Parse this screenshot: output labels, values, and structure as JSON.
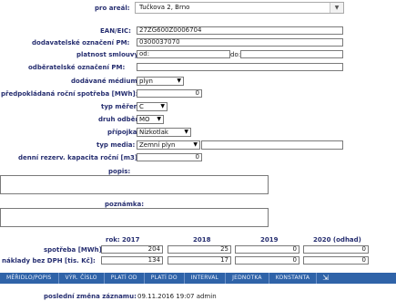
{
  "areal": {
    "label": "pro areál:",
    "value": "Tučkova 2, Brno"
  },
  "ean": {
    "label": "EAN/EIC:",
    "value": "27ZG600Z0006704"
  },
  "supplier_id": {
    "label": "dodavatelské označení PM:",
    "value": "0300037070"
  },
  "validity": {
    "label": "platnost smlouvy:",
    "od_label": "od:",
    "do_label": "do:",
    "od_value": "",
    "do_value": ""
  },
  "consumer_id": {
    "label": "odběratelské označení PM:",
    "value": ""
  },
  "medium": {
    "label": "dodávané médium:",
    "value": "plyn"
  },
  "expected": {
    "label": "předpokládaná roční spotřeba [MWh]:",
    "value": "0"
  },
  "meter_type": {
    "label": "typ měření:",
    "value": "C"
  },
  "offtake_type": {
    "label": "druh odběru:",
    "value": "MO"
  },
  "connection": {
    "label": "přípojka:",
    "value": "Nízkotlak"
  },
  "media_type": {
    "label": "typ media:",
    "value": "Zemní plyn",
    "extra": ""
  },
  "capacity": {
    "label": "denní rezerv. kapacita roční [m3]:",
    "value": "0"
  },
  "description": {
    "label": "popis:"
  },
  "note": {
    "label": "poznámka:"
  },
  "years": {
    "label": "rok:",
    "headers": [
      "2017",
      "2018",
      "2019",
      "2020 (odhad)"
    ],
    "consumption_label": "spotřeba [MWh]:",
    "consumption": [
      "204",
      "25",
      "0",
      "0"
    ],
    "costs_label": "náklady bez DPH [tis. Kč]:",
    "costs": [
      "134",
      "17",
      "0",
      "0"
    ]
  },
  "tabs": [
    "MĚŘIDLO/POPIS",
    "VÝR. ČÍSLO",
    "PLATÍ OD",
    "PLATÍ DO",
    "INTERVAL",
    "JEDNOTKA",
    "KONSTANTA"
  ],
  "footer": {
    "label": "poslední změna záznamu:",
    "value": "09.11.2016 19:07 admin"
  }
}
